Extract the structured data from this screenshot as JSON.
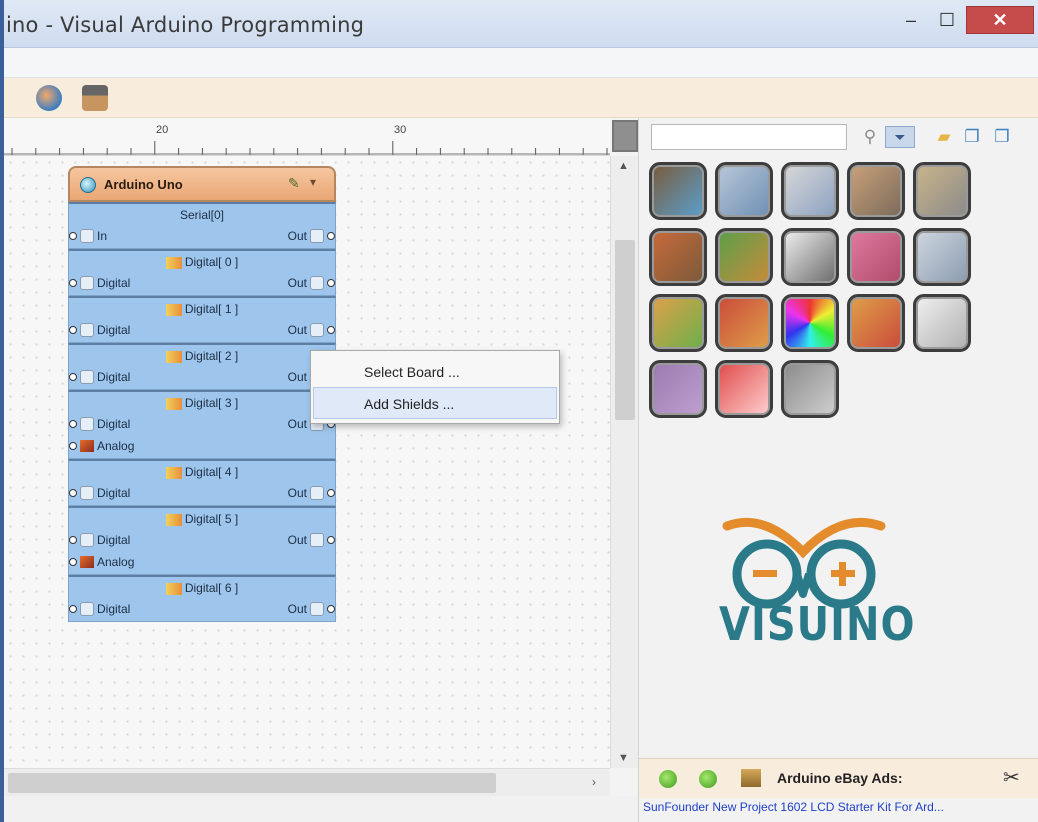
{
  "window": {
    "title": "ino - Visual Arduino Programming",
    "min_symbol": "–",
    "max_symbol": "☐",
    "close_symbol": "✕"
  },
  "ruler": {
    "labels": [
      "20",
      "30"
    ]
  },
  "component": {
    "title": "Arduino Uno",
    "settings_icon": "wrench-icon",
    "dropdown_symbol": "▾",
    "sections": [
      {
        "title": "Serial[0]",
        "rows": [
          {
            "left": "In",
            "right": "Out"
          }
        ]
      },
      {
        "title": "Digital[ 0 ]",
        "rows": [
          {
            "left": "Digital",
            "right": "Out"
          }
        ]
      },
      {
        "title": "Digital[ 1 ]",
        "rows": [
          {
            "left": "Digital",
            "right": "Out"
          }
        ]
      },
      {
        "title": "Digital[ 2 ]",
        "rows": [
          {
            "left": "Digital",
            "right": "Out"
          }
        ]
      },
      {
        "title": "Digital[ 3 ]",
        "rows": [
          {
            "left": "Digital",
            "right": "Out"
          },
          {
            "left": "Analog",
            "right": ""
          }
        ]
      },
      {
        "title": "Digital[ 4 ]",
        "rows": [
          {
            "left": "Digital",
            "right": "Out"
          }
        ]
      },
      {
        "title": "Digital[ 5 ]",
        "rows": [
          {
            "left": "Digital",
            "right": "Out"
          },
          {
            "left": "Analog",
            "right": ""
          }
        ]
      },
      {
        "title": "Digital[ 6 ]",
        "rows": [
          {
            "left": "Digital",
            "right": "Out"
          }
        ]
      }
    ]
  },
  "context_menu": {
    "items": [
      "Select Board ...",
      "Add Shields ..."
    ]
  },
  "palette": {
    "search_placeholder": "",
    "categories": [
      "category-1",
      "category-2",
      "category-3",
      "category-4",
      "category-5",
      "category-6",
      "category-7",
      "category-8",
      "category-9",
      "category-10",
      "category-11",
      "category-12",
      "category-13",
      "category-14",
      "category-15",
      "category-16",
      "category-17",
      "category-18"
    ]
  },
  "logo": {
    "text": "VISUINO"
  },
  "ads": {
    "title": "Arduino eBay Ads:",
    "link": "SunFounder New Project 1602 LCD Starter Kit For Ard..."
  },
  "colors": {
    "component_header": "#e9a775",
    "component_body": "#9ec6ec",
    "logo_orange": "#e48b2c",
    "logo_teal": "#2a7a8a",
    "close_button": "#c64b4b",
    "ads_link": "#1f3fc7"
  }
}
